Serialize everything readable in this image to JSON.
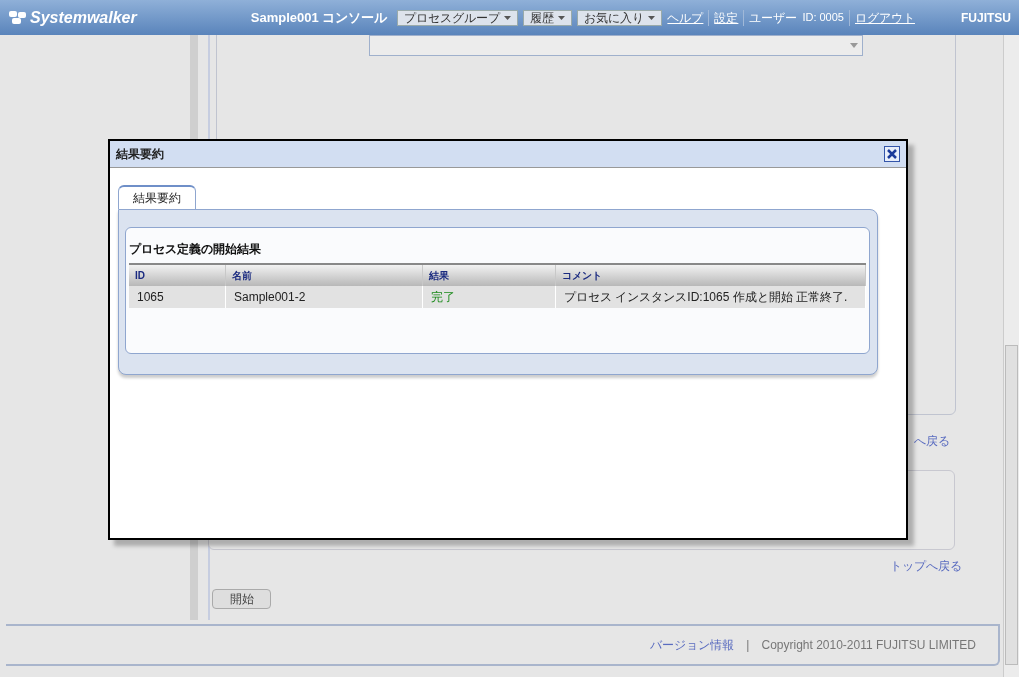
{
  "header": {
    "logo": "Systemwalker",
    "console_title": "Sample001 コンソール",
    "menus": [
      {
        "label": "プロセスグループ",
        "kind": "dropdown"
      },
      {
        "label": "履歴",
        "kind": "dropdown"
      },
      {
        "label": "お気に入り",
        "kind": "dropdown"
      },
      {
        "label": "ヘルプ",
        "kind": "link"
      },
      {
        "label": "設定",
        "kind": "link"
      }
    ],
    "user_label": "ユーザー",
    "user_id": "ID: 0005",
    "logout": "ログアウト",
    "brand": "FUJITSU"
  },
  "background": {
    "top_links": [
      "へ戻る",
      "トップへ戻る"
    ],
    "start_button": "開始"
  },
  "dialog": {
    "title": "結果要約",
    "tabs": [
      {
        "label": "結果要約",
        "selected": true
      }
    ],
    "section_title": "プロセス定義の開始結果",
    "table": {
      "columns": [
        "ID",
        "名前",
        "結果",
        "コメント"
      ],
      "rows": [
        [
          "1065",
          "Sample001-2",
          "完了",
          "プロセス インスタンスID:1065 作成と開始 正常終了."
        ]
      ]
    }
  },
  "footer": {
    "version_link": "バージョン情報",
    "separator": "|",
    "copyright": "Copyright 2010-2011 FUJITSU LIMITED"
  }
}
